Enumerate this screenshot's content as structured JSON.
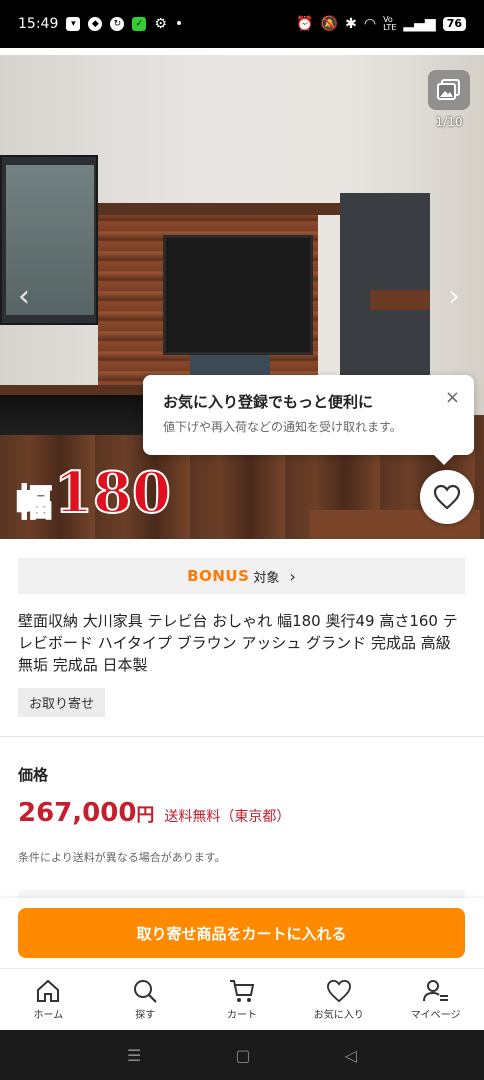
{
  "status_bar": {
    "time": "15:49",
    "battery": "76"
  },
  "gallery": {
    "counter": "1/10",
    "size_kanji": "幅",
    "size_number": "180"
  },
  "favorite_tip": {
    "title": "お気に入り登録でもっと便利に",
    "subtitle": "値下げや再入荷などの通知を受け取れます。",
    "close": "×"
  },
  "bonus": {
    "logo": "BONUS",
    "label": "対象"
  },
  "product": {
    "title": "壁面収納 大川家具 テレビ台 おしゃれ 幅180 奥行49 高さ160 テレビボード ハイタイプ ブラウン アッシュ グランド 完成品 高級 無垢 完成品 日本製",
    "order_badge": "お取り寄せ",
    "price_label": "価格",
    "price": "267,000",
    "price_unit": "円",
    "shipping": "送料無料（東京都）",
    "shipping_note": "条件により送料が異なる場合があります。"
  },
  "cart_button": "取り寄せ商品をカートに入れる",
  "tabs": [
    {
      "label": "ホーム",
      "icon": "home-icon"
    },
    {
      "label": "探す",
      "icon": "search-icon"
    },
    {
      "label": "カート",
      "icon": "cart-icon"
    },
    {
      "label": "お気に入り",
      "icon": "heart-icon"
    },
    {
      "label": "マイページ",
      "icon": "user-icon"
    }
  ],
  "colors": {
    "accent": "#ff8a00",
    "price": "#c41f2d",
    "size_label": "#e01020"
  }
}
